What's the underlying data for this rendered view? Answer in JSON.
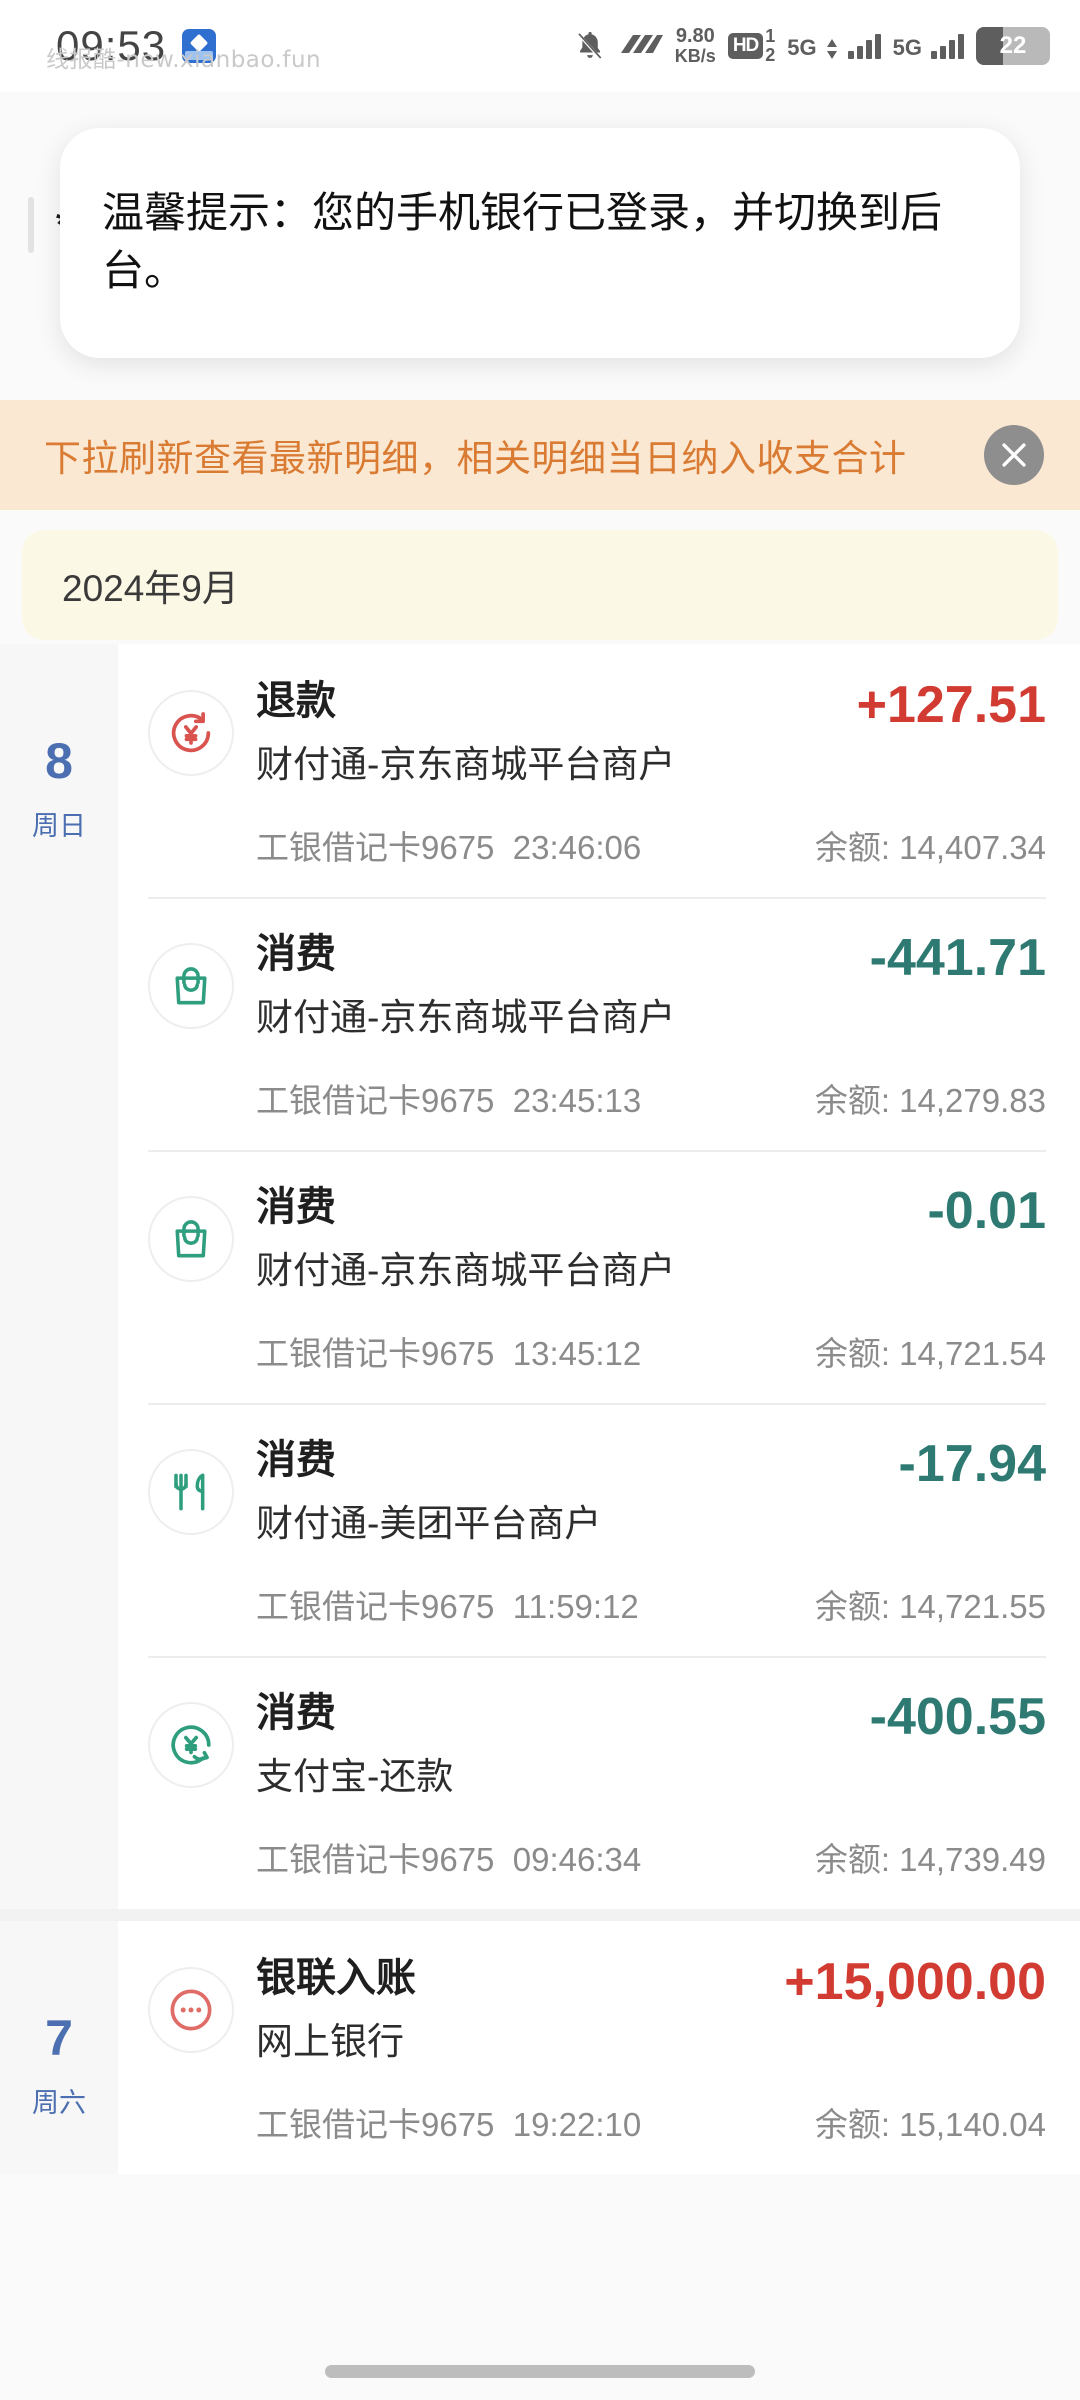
{
  "status_bar": {
    "time": "09:53",
    "app_badge_icon": "app-badge-icon",
    "mute_icon": "bell-muted-icon",
    "vpn_icon": "vpn-arrows-icon",
    "network_speed": "9.80",
    "network_speed_unit": "KB/s",
    "hd_label": "HD",
    "hd_sim": "1\n2",
    "hd_sim_top": "1",
    "hd_sim_bottom": "2",
    "sim1_label": "5G",
    "sim2_label": "5G",
    "battery_percent": "22"
  },
  "watermark": {
    "text": "线报酷-new.xianbao.fun"
  },
  "toast": {
    "message": "温馨提示：您的手机银行已登录，并切换到后台。"
  },
  "masked_account": {
    "text": "*:"
  },
  "banner": {
    "text": "下拉刷新查看最新明细，相关明细当日纳入收支合计",
    "close_icon": "close-icon"
  },
  "month_header": {
    "label": "2024年9月"
  },
  "colors": {
    "income": "#d23b32",
    "expense": "#2e7a72",
    "banner_bg": "#fbe8d2",
    "banner_text": "#d97b33",
    "month_bg": "#fcf8e6",
    "day_text": "#4b6fb0"
  },
  "days": [
    {
      "day": "8",
      "weekday": "周日",
      "transactions": [
        {
          "icon": "refund-yuan-icon",
          "icon_color": "#d9534f",
          "title": "退款",
          "merchant": "财付通-京东商城平台商户",
          "amount": "+127.51",
          "amount_type": "income",
          "card": "工银借记卡9675",
          "time": "23:46:06",
          "balance": "余额: 14,407.34"
        },
        {
          "icon": "shopping-bag-icon",
          "icon_color": "#2e9e7e",
          "title": "消费",
          "merchant": "财付通-京东商城平台商户",
          "amount": "-441.71",
          "amount_type": "expense",
          "card": "工银借记卡9675",
          "time": "23:45:13",
          "balance": "余额: 14,279.83"
        },
        {
          "icon": "shopping-bag-icon",
          "icon_color": "#2e9e7e",
          "title": "消费",
          "merchant": "财付通-京东商城平台商户",
          "amount": "-0.01",
          "amount_type": "expense",
          "card": "工银借记卡9675",
          "time": "13:45:12",
          "balance": "余额: 14,721.54"
        },
        {
          "icon": "restaurant-icon",
          "icon_color": "#2e9e7e",
          "title": "消费",
          "merchant": "财付通-美团平台商户",
          "amount": "-17.94",
          "amount_type": "expense",
          "card": "工银借记卡9675",
          "time": "11:59:12",
          "balance": "余额: 14,721.55"
        },
        {
          "icon": "repayment-yuan-icon",
          "icon_color": "#2e9e7e",
          "title": "消费",
          "merchant": "支付宝-还款",
          "amount": "-400.55",
          "amount_type": "expense",
          "card": "工银借记卡9675",
          "time": "09:46:34",
          "balance": "余额: 14,739.49"
        }
      ]
    },
    {
      "day": "7",
      "weekday": "周六",
      "transactions": [
        {
          "icon": "more-dots-circle-icon",
          "icon_color": "#e06c68",
          "title": "银联入账",
          "merchant": "网上银行",
          "amount": "+15,000.00",
          "amount_type": "income",
          "card": "工银借记卡9675",
          "time": "19:22:10",
          "balance": "余额: 15,140.04"
        }
      ]
    }
  ]
}
